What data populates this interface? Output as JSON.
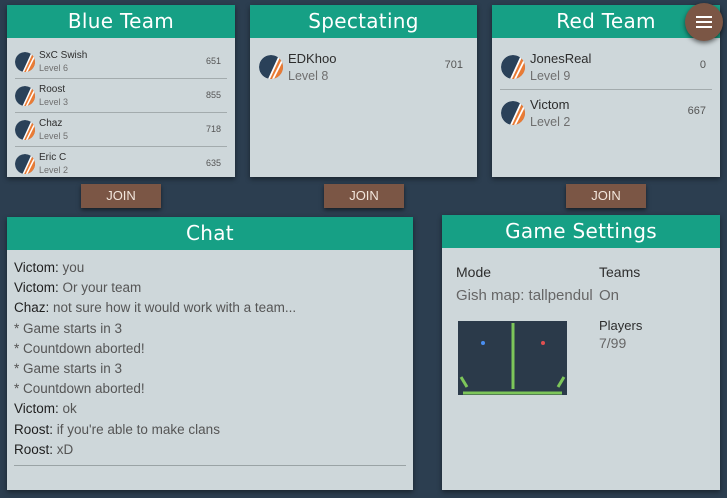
{
  "teams": {
    "blue": {
      "title": "Blue Team",
      "join_label": "JOIN",
      "players": [
        {
          "name": "SxC Swish",
          "level": "Level 6",
          "score": "651"
        },
        {
          "name": "Roost",
          "level": "Level 3",
          "score": "855"
        },
        {
          "name": "Chaz",
          "level": "Level 5",
          "score": "718"
        },
        {
          "name": "Eric C",
          "level": "Level 2",
          "score": "635"
        }
      ]
    },
    "spectating": {
      "title": "Spectating",
      "join_label": "JOIN",
      "players": [
        {
          "name": "EDKhoo",
          "level": "Level 8",
          "score": "701"
        }
      ]
    },
    "red": {
      "title": "Red Team",
      "join_label": "JOIN",
      "players": [
        {
          "name": "JonesReal",
          "level": "Level 9",
          "score": "0"
        },
        {
          "name": "Victom",
          "level": "Level 2",
          "score": "667"
        }
      ]
    }
  },
  "chat": {
    "title": "Chat",
    "messages": [
      {
        "author": "Victom:",
        "text": " you"
      },
      {
        "author": "Victom:",
        "text": " Or your team"
      },
      {
        "author": "Chaz:",
        "text": " not sure how it would work with a team..."
      },
      {
        "author": "",
        "text": "* Game starts in 3"
      },
      {
        "author": "",
        "text": "* Countdown aborted!"
      },
      {
        "author": "",
        "text": "* Game starts in 3"
      },
      {
        "author": "",
        "text": "* Countdown aborted!"
      },
      {
        "author": "Victom:",
        "text": " ok"
      },
      {
        "author": "Roost:",
        "text": " if you're able to make clans"
      },
      {
        "author": "Roost:",
        "text": " xD"
      }
    ]
  },
  "settings": {
    "title": "Game Settings",
    "mode_label": "Mode",
    "mode_value": "Gish map: tallpendul",
    "teams_label": "Teams",
    "teams_value": "On",
    "players_label": "Players",
    "players_value": "7/99"
  },
  "colors": {
    "header": "#16a085",
    "panel": "#ced7da",
    "background": "#2c3e50",
    "join_button": "#7b5645",
    "avatar_blue": "#2a4159",
    "avatar_orange": "#e97b35",
    "blue_dot": "#4a8ff0",
    "red_dot": "#e05050",
    "map_line": "#7dc65a"
  },
  "icons": {
    "menu": "hamburger-menu-icon",
    "avatar": "player-avatar-icon"
  }
}
